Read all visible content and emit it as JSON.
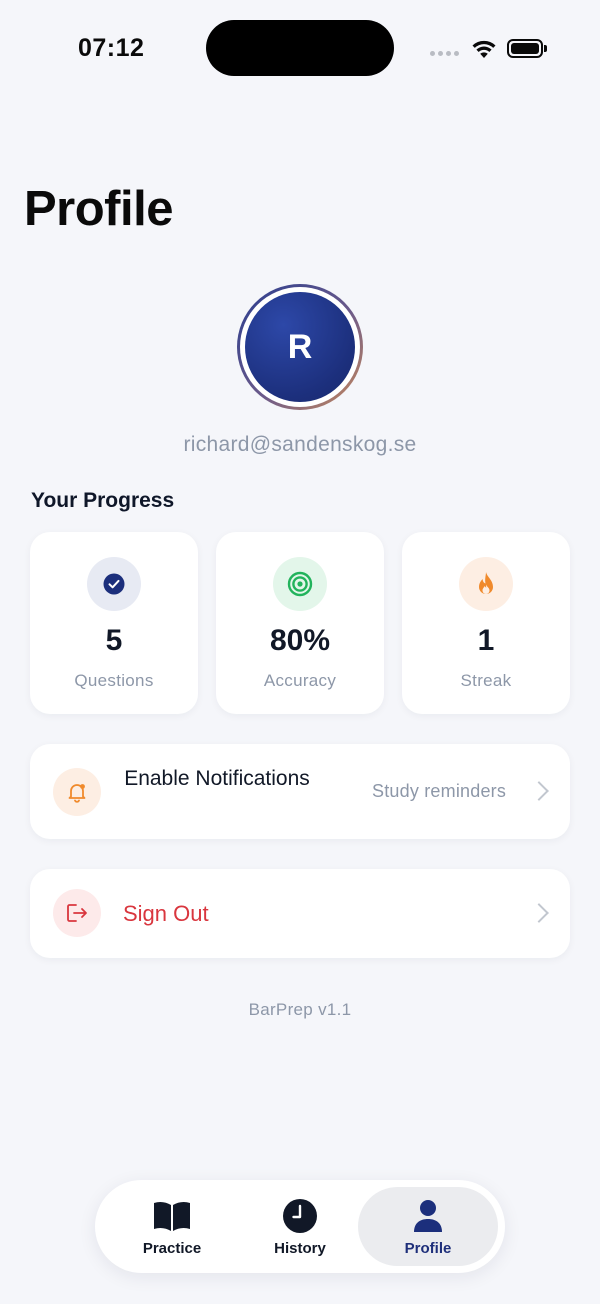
{
  "status_bar": {
    "time": "07:12"
  },
  "page": {
    "title": "Profile"
  },
  "profile": {
    "avatar_initial": "R",
    "email": "richard@sandenskog.se"
  },
  "progress": {
    "title": "Your Progress",
    "stats": [
      {
        "value": "5",
        "label": "Questions",
        "icon": "check-icon"
      },
      {
        "value": "80%",
        "label": "Accuracy",
        "icon": "target-icon"
      },
      {
        "value": "1",
        "label": "Streak",
        "icon": "flame-icon"
      }
    ]
  },
  "settings": {
    "notifications": {
      "title": "Enable Notifications",
      "subtitle": "Study reminders",
      "icon": "bell-icon"
    },
    "sign_out": {
      "label": "Sign Out",
      "icon": "sign-out-icon"
    }
  },
  "footer": {
    "version": "BarPrep v1.1"
  },
  "tabbar": {
    "tabs": [
      {
        "label": "Practice",
        "icon": "book-icon",
        "active": false
      },
      {
        "label": "History",
        "icon": "clock-icon",
        "active": false
      },
      {
        "label": "Profile",
        "icon": "person-icon",
        "active": true
      }
    ]
  },
  "colors": {
    "background": "#f5f6fa",
    "brand": "#1c2f7c",
    "danger": "#d9363e",
    "accuracy_green": "#22b35c",
    "streak_orange": "#f08a2c"
  }
}
